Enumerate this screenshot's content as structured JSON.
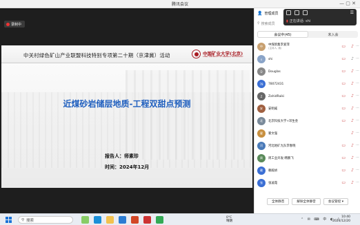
{
  "window": {
    "title": "腾讯会议",
    "controls": "—  ▢  ✕"
  },
  "recording": {
    "label": "录制中"
  },
  "slide": {
    "header": "中关村绿色矿山产业联盟科技特别专项第二十期（京津冀）活动",
    "logo_text": "中国矿业大学(北京)",
    "logo_sub": "CHINA UNIVERSITY OF MINING & TECHNOLOGY",
    "title": "近煤砂岩储层地质-工程双甜点预测",
    "reporter": "报告人：师素珍",
    "time": "时间：2024年12月"
  },
  "panel": {
    "header": "管理成员",
    "search_placeholder": "搜索成员",
    "speaking_label": "正在讲话:",
    "speaking_name": "shi",
    "tabs": [
      "会议中(45)",
      "未入会"
    ],
    "footer": [
      "全体静音",
      "解除全体静音",
      "会议管控 ▾"
    ]
  },
  "participants": [
    {
      "name": "中煤新集李爱萍",
      "sub": "(主持人, 我)",
      "avatar": "中",
      "color": "#c8a070",
      "video": true,
      "mic": true
    },
    {
      "name": "shi",
      "sub": "",
      "avatar": "s",
      "color": "#8aa4c8",
      "video": true,
      "mic": false
    },
    {
      "name": "Douglas",
      "sub": "",
      "avatar": "D",
      "color": "#888888",
      "video": true,
      "mic": true
    },
    {
      "name": "78072431",
      "sub": "",
      "avatar": "78",
      "color": "#3b6fd4",
      "video": true,
      "mic": true
    },
    {
      "name": "ZahidRaiki",
      "sub": "",
      "avatar": "Z",
      "color": "#666666",
      "video": true,
      "mic": true
    },
    {
      "name": "安明威",
      "sub": "",
      "avatar": "安",
      "color": "#a06040",
      "video": true,
      "mic": true
    },
    {
      "name": "北京科技大学+邓生金",
      "sub": "",
      "avatar": "北",
      "color": "#7a8a9a",
      "video": true,
      "mic": true
    },
    {
      "name": "翟文强",
      "sub": "",
      "avatar": "翟",
      "color": "#c89040",
      "video": false,
      "mic": true
    },
    {
      "name": "河北地矿九队李春晓",
      "sub": "",
      "avatar": "河",
      "color": "#4a7ab8",
      "video": true,
      "mic": true
    },
    {
      "name": "周工业开发-韩鹏飞",
      "sub": "",
      "avatar": "周",
      "color": "#5a8a5a",
      "video": true,
      "mic": true
    },
    {
      "name": "赖殿娇",
      "sub": "",
      "avatar": "赖",
      "color": "#3b6fd4",
      "video": true,
      "mic": true
    },
    {
      "name": "张凌霞",
      "sub": "",
      "avatar": "张",
      "color": "#3b6fd4",
      "video": true,
      "mic": true
    }
  ],
  "taskbar": {
    "search": "搜索",
    "weather_temp": "0°C",
    "weather_desc": "晴朗",
    "time": "10:40",
    "date": "2024/12/20"
  },
  "colors": {
    "accent": "#1f5fbf",
    "brand_red": "#a71b22",
    "mute_red": "#cc4444"
  }
}
